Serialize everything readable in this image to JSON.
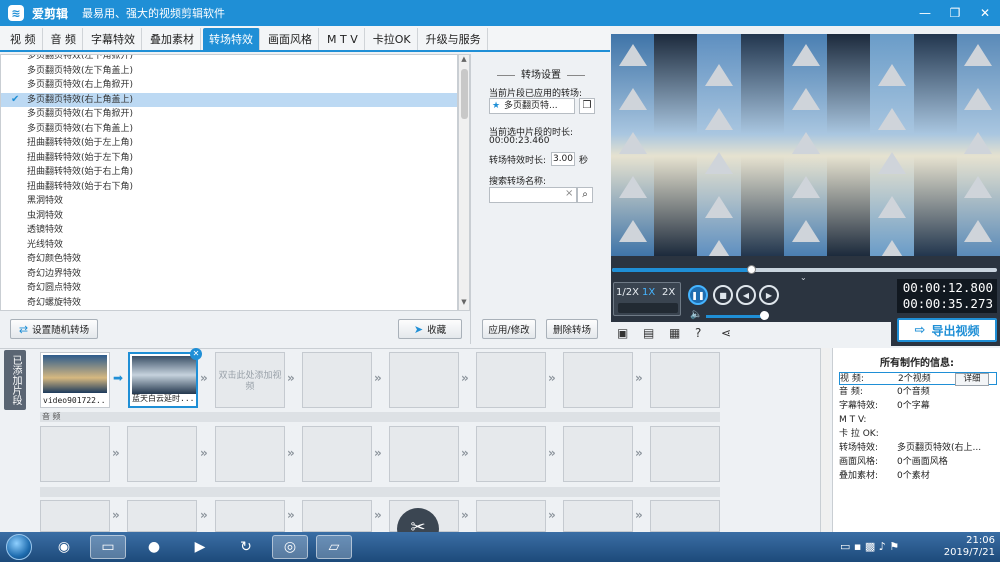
{
  "app": {
    "logo_text": "≋",
    "title": "爱剪辑",
    "subtitle": "最易用、强大的视频剪辑软件",
    "controls": [
      "—",
      "❐",
      "✕"
    ]
  },
  "tabs": [
    "视 频",
    "音 频",
    "字幕特效",
    "叠加素材",
    "转场特效",
    "画面风格",
    "M T V",
    "卡拉OK",
    "升级与服务"
  ],
  "active_tab": "转场特效",
  "effects": [
    "多页翻页特效(左下角掀开)",
    "多页翻页特效(左下角盖上)",
    "多页翻页特效(右上角掀开)",
    "多页翻页特效(右上角盖上)",
    "多页翻页特效(右下角掀开)",
    "多页翻页特效(右下角盖上)",
    "扭曲翻转特效(始于左上角)",
    "扭曲翻转特效(始于左下角)",
    "扭曲翻转特效(始于右上角)",
    "扭曲翻转特效(始于右下角)",
    "黑洞特效",
    "虫洞特效",
    "透镜特效",
    "光线特效",
    "奇幻颜色特效",
    "奇幻边界特效",
    "奇幻圆点特效",
    "奇幻螺旋特效"
  ],
  "selected_effect_index": 3,
  "buttons": {
    "random": "设置随机转场",
    "favorite": "收藏",
    "apply": "应用/修改",
    "delete": "删除转场",
    "export": "导出视频",
    "detail": "详细"
  },
  "settings": {
    "title": "转场设置",
    "applied_label": "当前片段已应用的转场:",
    "applied_value": "多页翻页特...",
    "clip_duration_label": "当前选中片段的时长:",
    "clip_duration_value": "00:00:23.460",
    "effect_duration_label": "转场特效时长:",
    "effect_duration_value": "3.00",
    "effect_duration_unit": "秒",
    "search_label": "搜索转场名称:",
    "search_value": "",
    "clear_icon": "×"
  },
  "player": {
    "progress": 0.36,
    "speeds": [
      "1/2X",
      "1X",
      "2X"
    ],
    "active_speed": "1X",
    "time_current": "00:00:12.800",
    "time_total": "00:00:35.273",
    "volume": 0.95
  },
  "timeline": {
    "side_label": "已添加片段",
    "clips": [
      {
        "name": "video901722..."
      },
      {
        "name": "蓝天白云延时..."
      }
    ],
    "add_hint": "双击此处添加视频",
    "audio_label": "音 频"
  },
  "info": {
    "title": "所有制作的信息:",
    "rows": [
      {
        "k": "视    频:",
        "v": "2个视频"
      },
      {
        "k": "音    频:",
        "v": "0个音频"
      },
      {
        "k": "字幕特效:",
        "v": "0个字幕"
      },
      {
        "k": "M  T  V:",
        "v": ""
      },
      {
        "k": "卡 拉 OK:",
        "v": ""
      },
      {
        "k": "转场特效:",
        "v": "多页翻页特效(右上..."
      },
      {
        "k": "画面风格:",
        "v": "0个画面风格"
      },
      {
        "k": "叠加素材:",
        "v": "0个素材"
      }
    ]
  },
  "taskbar": {
    "time": "21:06",
    "date": "2019/7/21"
  },
  "colors": {
    "accent": "#1f8fd6",
    "title_bar": "#1f8fd6",
    "selected_row": "#bcd9f3",
    "player_bg": "#2b3440"
  }
}
